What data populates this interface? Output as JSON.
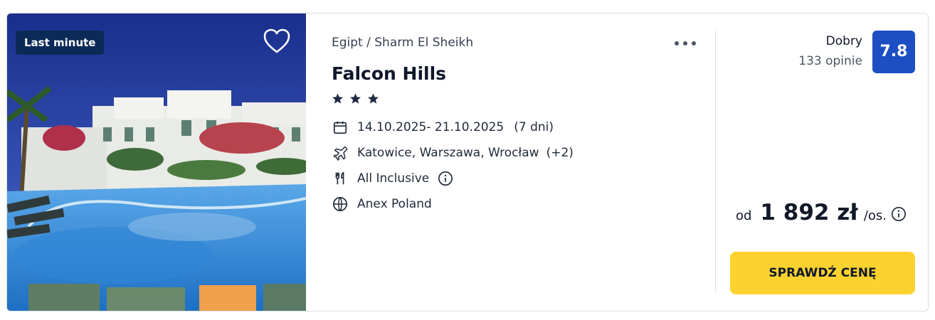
{
  "card": {
    "badge": "Last minute",
    "location": "Egipt / Sharm El Sheikh",
    "hotel_name": "Falcon Hills",
    "stars": 3,
    "dates": "14.10.2025- 21.10.2025",
    "duration": "(7 dni)",
    "departures": "Katowice, Warszawa, Wrocław",
    "departures_more": "(+2)",
    "board": "All Inclusive",
    "operator": "Anex Poland",
    "rating_label": "Dobry",
    "rating_count": "133 opinie",
    "score": "7.8",
    "price_prefix": "od",
    "price": "1 892 zł",
    "price_unit": "/os.",
    "cta_label": "SPRAWDŹ CENĘ"
  },
  "icons": {
    "favorite": "heart-icon",
    "more": "more-dots-icon",
    "dates": "calendar-icon",
    "departures": "plane-icon",
    "board": "cutlery-icon",
    "board_info": "info-icon",
    "operator": "globe-icon",
    "price_info": "info-icon"
  },
  "colors": {
    "badge_bg": "#0b2a57",
    "score_bg": "#1d4fc3",
    "cta_bg": "#fcd22f",
    "star": "#1f2a44"
  }
}
